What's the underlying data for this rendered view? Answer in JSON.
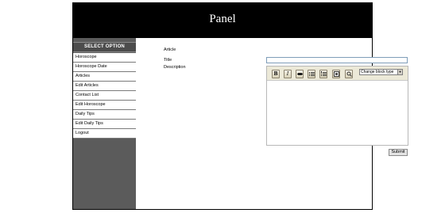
{
  "header": {
    "title": "Panel"
  },
  "sidebar": {
    "heading": "SELECT OPTION",
    "items": [
      {
        "label": "Horoscope"
      },
      {
        "label": "Horoscope Date"
      },
      {
        "label": "Articles"
      },
      {
        "label": "Edit Articles"
      },
      {
        "label": "Contact List"
      },
      {
        "label": "Edit Horoscope"
      },
      {
        "label": "Daily Tips"
      },
      {
        "label": "Edit Daily Tips"
      },
      {
        "label": "Logout"
      }
    ]
  },
  "form": {
    "section_label": "Article",
    "title_label": "Title",
    "title_value": "",
    "description_label": "Description",
    "toolbar": {
      "bold": "B",
      "italic": "I",
      "block_type": "Change block type"
    },
    "submit_label": "Submit"
  }
}
